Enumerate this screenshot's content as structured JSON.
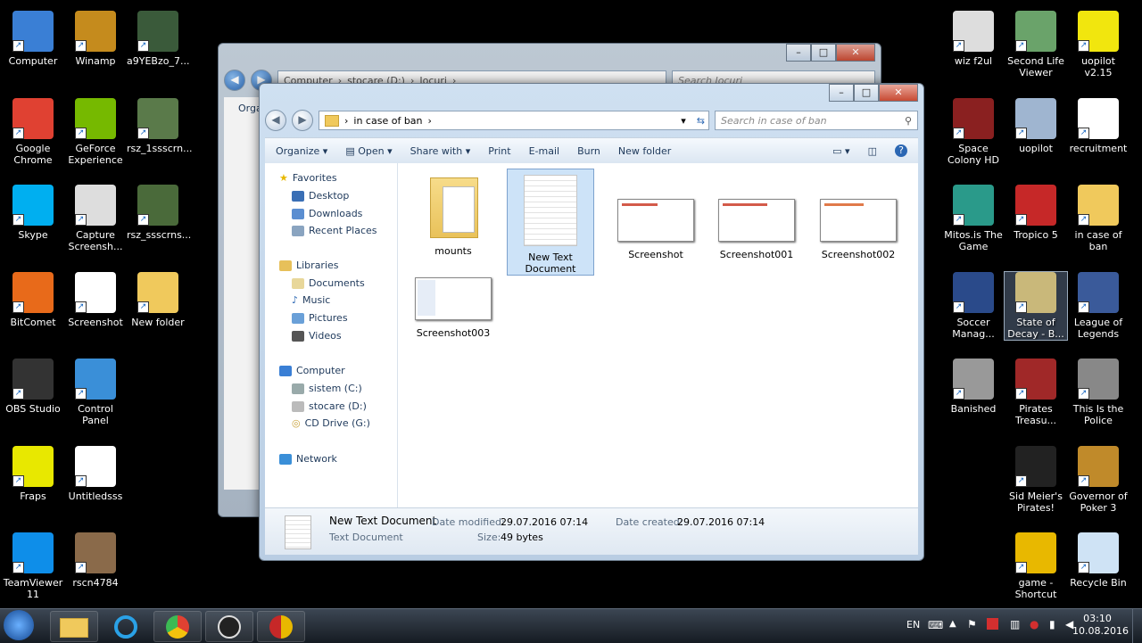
{
  "desktop_left": [
    {
      "label": "Computer",
      "icon": "computer-icon",
      "color": "#3a7fd5"
    },
    {
      "label": "Google Chrome",
      "icon": "chrome-icon",
      "color": "#e04132"
    },
    {
      "label": "Skype",
      "icon": "skype-icon",
      "color": "#00aff0"
    },
    {
      "label": "BitComet",
      "icon": "bitcomet-icon",
      "color": "#e86a1a"
    },
    {
      "label": "OBS Studio",
      "icon": "obs-icon",
      "color": "#333333"
    },
    {
      "label": "Fraps",
      "icon": "fraps-icon",
      "color": "#e8e800"
    },
    {
      "label": "TeamViewer 11",
      "icon": "teamviewer-icon",
      "color": "#0e8ee9"
    }
  ],
  "desktop_left2": [
    {
      "label": "Winamp",
      "icon": "winamp-icon",
      "color": "#c58b1d"
    },
    {
      "label": "GeForce Experience",
      "icon": "geforce-icon",
      "color": "#76b900"
    },
    {
      "label": "Capture Screensh...",
      "icon": "capture-icon",
      "color": "#dddddd"
    },
    {
      "label": "Screenshot",
      "icon": "screenshot-thumb-icon",
      "color": "#ffffff"
    },
    {
      "label": "Control Panel",
      "icon": "control-panel-icon",
      "color": "#3a8fd8"
    },
    {
      "label": "Untitledsss",
      "icon": "image-thumb-icon",
      "color": "#ffffff"
    },
    {
      "label": "rscn4784",
      "icon": "image-thumb-icon",
      "color": "#8a6a4a"
    }
  ],
  "desktop_left3": [
    {
      "label": "a9YEBzo_7...",
      "icon": "image-thumb-icon",
      "color": "#3a5a3a"
    },
    {
      "label": "rsz_1ssscrn...",
      "icon": "image-thumb-icon",
      "color": "#5a7a4a"
    },
    {
      "label": "rsz_ssscrns...",
      "icon": "image-thumb-icon",
      "color": "#4a6a3a"
    },
    {
      "label": "New folder",
      "icon": "folder-icon",
      "color": "#f0c95c"
    }
  ],
  "desktop_right1": [
    {
      "label": "wiz f2ul",
      "icon": "image-thumb-icon",
      "color": "#dddddd"
    },
    {
      "label": "Space Colony HD",
      "icon": "space-colony-icon",
      "color": "#8a2020"
    },
    {
      "label": "Mitos.is The Game",
      "icon": "mitosis-icon",
      "color": "#2a9a8a"
    },
    {
      "label": "Soccer Manag...",
      "icon": "soccer-manager-icon",
      "color": "#2a4a8a"
    },
    {
      "label": "Banished",
      "icon": "banished-icon",
      "color": "#999999"
    }
  ],
  "desktop_right2": [
    {
      "label": "Second Life Viewer",
      "icon": "second-life-icon",
      "color": "#6aa36a"
    },
    {
      "label": "uopilot",
      "icon": "gear-icon",
      "color": "#9fb5d0"
    },
    {
      "label": "Tropico 5",
      "icon": "tropico-icon",
      "color": "#c62828"
    },
    {
      "label": "State of Decay - B...",
      "icon": "state-of-decay-icon",
      "color": "#c9b87a"
    },
    {
      "label": "Pirates Treasu...",
      "icon": "pirates-treasure-icon",
      "color": "#a02828"
    },
    {
      "label": "Sid Meier's Pirates!",
      "icon": "pirates-icon",
      "color": "#222222"
    },
    {
      "label": "game - Shortcut",
      "icon": "yin-yang-icon",
      "color": "#e8b800"
    }
  ],
  "desktop_right3": [
    {
      "label": "uopilot v2.15",
      "icon": "smiley-icon",
      "color": "#f1e60e"
    },
    {
      "label": "recruitment",
      "icon": "document-icon",
      "color": "#ffffff"
    },
    {
      "label": "in case of ban",
      "icon": "folder-icon",
      "color": "#f0c95c"
    },
    {
      "label": "League of Legends",
      "icon": "league-icon",
      "color": "#3a5a9a"
    },
    {
      "label": "This Is the Police",
      "icon": "police-icon",
      "color": "#888888"
    },
    {
      "label": "Governor of Poker 3",
      "icon": "poker-icon",
      "color": "#c08a2a"
    },
    {
      "label": "Recycle Bin",
      "icon": "recycle-bin-icon",
      "color": "#cfe3f5"
    }
  ],
  "back_window": {
    "path": [
      "Computer",
      "stocare (D:)",
      "Jocuri"
    ],
    "search_placeholder": "Search Jocuri",
    "toolbar_fragment": "Organ"
  },
  "front_window": {
    "path": "in case of ban",
    "search_placeholder": "Search in case of ban",
    "toolbar": [
      "Organize",
      "Open",
      "Share with",
      "Print",
      "E-mail",
      "Burn",
      "New folder"
    ],
    "nav": {
      "favorites": "Favorites",
      "favorites_items": [
        "Desktop",
        "Downloads",
        "Recent Places"
      ],
      "libraries": "Libraries",
      "libraries_items": [
        "Documents",
        "Music",
        "Pictures",
        "Videos"
      ],
      "computer": "Computer",
      "computer_items": [
        "sistem (C:)",
        "stocare (D:)",
        "CD Drive (G:)"
      ],
      "network": "Network"
    },
    "files": [
      {
        "name": "mounts",
        "type": "folder"
      },
      {
        "name": "New Text Document",
        "type": "text",
        "selected": true
      },
      {
        "name": "Screenshot",
        "type": "image"
      },
      {
        "name": "Screenshot001",
        "type": "image"
      },
      {
        "name": "Screenshot002",
        "type": "image"
      },
      {
        "name": "Screenshot003",
        "type": "image"
      }
    ],
    "details": {
      "name": "New Text Document",
      "type": "Text Document",
      "modified_label": "Date modified:",
      "modified": "29.07.2016 07:14",
      "created_label": "Date created:",
      "created": "29.07.2016 07:14",
      "size_label": "Size:",
      "size": "49 bytes"
    }
  },
  "taskbar": {
    "lang": "EN",
    "time": "03:10",
    "date": "10.08.2016",
    "apps": [
      "windows-start-icon",
      "explorer-icon",
      "ie-icon",
      "chrome-icon",
      "obs-icon",
      "game-icon"
    ]
  }
}
